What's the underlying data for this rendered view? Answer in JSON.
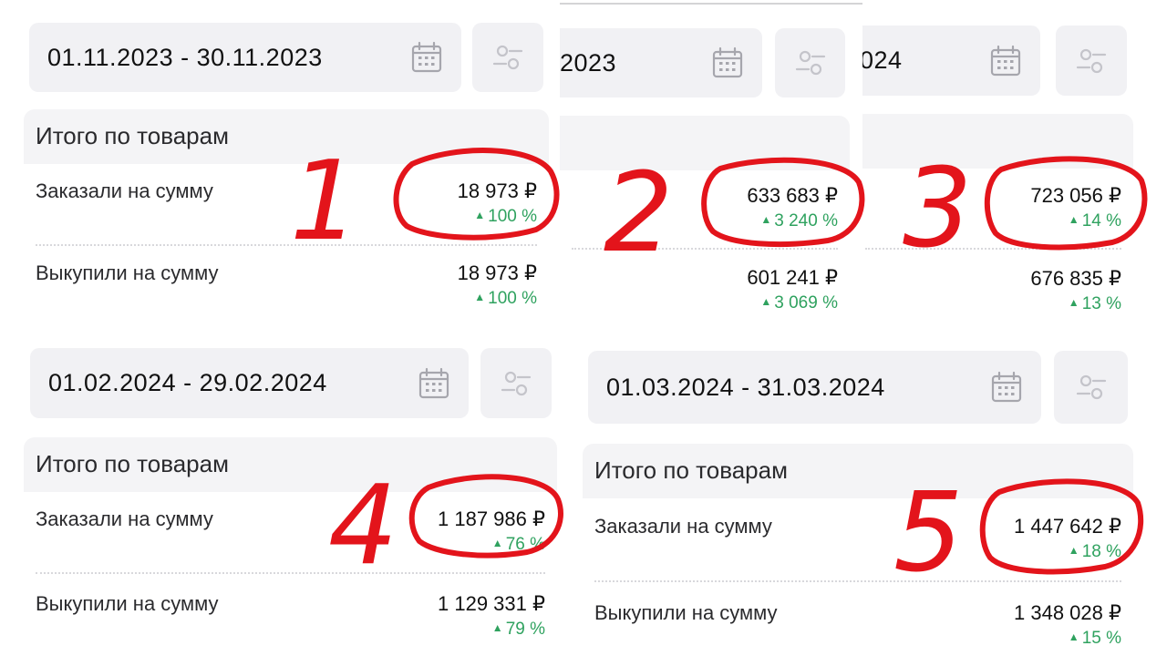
{
  "panels": [
    {
      "date_range": "01.11.2023 - 30.11.2023",
      "card_title": "Итого по товарам",
      "ordered": {
        "label": "Заказали на сумму",
        "value": "18 973 ₽",
        "delta": "100 %"
      },
      "bought": {
        "label": "Выкупили на сумму",
        "value": "18 973 ₽",
        "delta": "100 %"
      }
    },
    {
      "date_range": "2023",
      "ordered": {
        "value": "633 683 ₽",
        "delta": "3 240 %"
      },
      "bought": {
        "value": "601 241 ₽",
        "delta": "3 069 %"
      }
    },
    {
      "date_range": "024",
      "ordered": {
        "value": "723 056 ₽",
        "delta": "14 %"
      },
      "bought": {
        "value": "676 835 ₽",
        "delta": "13 %"
      }
    },
    {
      "date_range": "01.02.2024 - 29.02.2024",
      "card_title": "Итого по товарам",
      "ordered": {
        "label": "Заказали на сумму",
        "value": "1 187 986 ₽",
        "delta": "76 %"
      },
      "bought": {
        "label": "Выкупили на сумму",
        "value": "1 129 331 ₽",
        "delta": "79 %"
      }
    },
    {
      "date_range": "01.03.2024 - 31.03.2024",
      "card_title": "Итого по товарам",
      "ordered": {
        "label": "Заказали на сумму",
        "value": "1 447 642 ₽",
        "delta": "18 %"
      },
      "bought": {
        "label": "Выкупили на сумму",
        "value": "1 348 028 ₽",
        "delta": "15 %"
      }
    }
  ],
  "annotations": [
    "1",
    "2",
    "3",
    "4",
    "5"
  ],
  "colors": {
    "accent_green": "#2fa25f",
    "annotation_red": "#e3141b",
    "bar_bg": "#f1f1f4"
  },
  "icons": {
    "calendar": "calendar-icon",
    "filter": "filter-sliders-icon"
  }
}
